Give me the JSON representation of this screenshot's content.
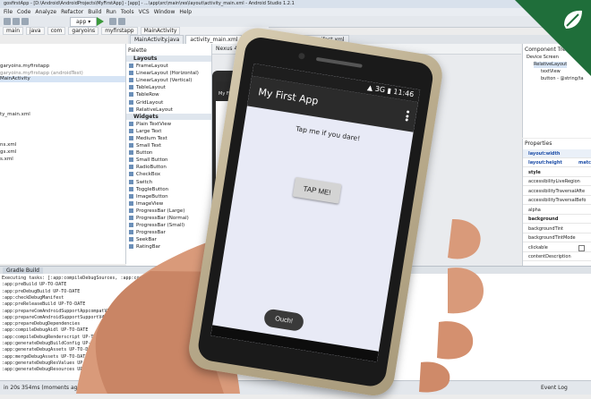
{
  "ide": {
    "title": "gosfirstApp - [D:\\Android\\AndroidProjects\\MyFirstApp] - [app] - ...\\app\\src\\main\\res\\layout\\activity_main.xml - Android Studio 1.2.1",
    "menu": [
      "File",
      "Code",
      "Analyze",
      "Refactor",
      "Build",
      "Run",
      "Tools",
      "VCS",
      "Window",
      "Help"
    ],
    "toolbar_module": "app",
    "breadcrumbs": [
      "main",
      "java",
      "com",
      "garyoins",
      "myfirstapp",
      "MainActivity"
    ],
    "editor_tabs": [
      {
        "label": "MainActivity.java",
        "active": false
      },
      {
        "label": "activity_main.xml",
        "active": true
      },
      {
        "label": "strings.xml",
        "active": false
      },
      {
        "label": "AndroidManifest.xml",
        "active": false
      }
    ],
    "project_tree": [
      {
        "label": "garyoins.myfirstapp",
        "style": "normal"
      },
      {
        "label": "garyoins.myfirstapp (androidTest)",
        "style": "faint"
      },
      {
        "label": "MainActivity",
        "style": "sel"
      },
      {
        "label": "ty_main.xml",
        "style": "normal"
      },
      {
        "label": "ns.xml",
        "style": "normal"
      },
      {
        "label": "gs.xml",
        "style": "normal"
      },
      {
        "label": "s.xml",
        "style": "normal"
      }
    ],
    "palette": {
      "title": "Palette",
      "sections": [
        {
          "name": "Layouts",
          "items": [
            "FrameLayout",
            "LinearLayout (Horizontal)",
            "LinearLayout (Vertical)",
            "TableLayout",
            "TableRow",
            "GridLayout",
            "RelativeLayout"
          ]
        },
        {
          "name": "Widgets",
          "items": [
            "Plain TextView",
            "Large Text",
            "Medium Text",
            "Small Text",
            "Button",
            "Small Button",
            "RadioButton",
            "CheckBox",
            "Switch",
            "ToggleButton",
            "ImageButton",
            "ImageView",
            "ProgressBar (Large)",
            "ProgressBar (Normal)",
            "ProgressBar (Small)",
            "ProgressBar",
            "SeekBar",
            "RatingBar"
          ]
        }
      ]
    },
    "canvas_toolbar": [
      "Nexus 4",
      "AppTheme",
      "API 22"
    ],
    "preview_title": "My First App",
    "component_tree": {
      "title": "Component Tree",
      "items": [
        {
          "label": "Device Screen"
        },
        {
          "label": "RelativeLayout"
        },
        {
          "label": "textView"
        },
        {
          "label": "button - @string/ta"
        }
      ]
    },
    "properties": {
      "title": "Properties",
      "header": "layout:width",
      "rows": [
        {
          "label": "layout:height",
          "value": "match",
          "style": "blue"
        },
        {
          "label": "style",
          "value": "",
          "style": "b"
        },
        {
          "label": "accessibilityLiveRegion",
          "value": "",
          "style": ""
        },
        {
          "label": "accessibilityTraversalAfte",
          "value": "",
          "style": ""
        },
        {
          "label": "accessibilityTraversalBefo",
          "value": "",
          "style": ""
        },
        {
          "label": "alpha",
          "value": "",
          "style": ""
        },
        {
          "label": "background",
          "value": "",
          "style": "b"
        },
        {
          "label": "backgroundTint",
          "value": "",
          "style": ""
        },
        {
          "label": "backgroundTintMode",
          "value": "",
          "style": ""
        },
        {
          "label": "clickable",
          "value": "",
          "style": ""
        },
        {
          "label": "contentDescription",
          "value": "",
          "style": ""
        }
      ]
    },
    "bottom_tabs": [
      "Gradle Build"
    ],
    "console_lines": [
      "Executing tasks: [:app:compileDebugSources, :app:compileDebugAndroidTestSources]",
      ":app:preBuild UP-TO-DATE",
      ":app:preDebugBuild UP-TO-DATE",
      ":app:checkDebugManifest",
      ":app:preReleaseBuild UP-TO-DATE",
      ":app:prepareComAndroidSupportAppcompatV72221Library",
      ":app:prepareComAndroidSupportSupportV42221Library",
      ":app:prepareDebugDependencies",
      ":app:compileDebugAidl UP-TO-DATE",
      ":app:compileDebugRenderscript UP-TO-DATE",
      ":app:generateDebugBuildConfig UP-TO-DATE",
      ":app:generateDebugAssets UP-TO-DATE",
      ":app:mergeDebugAssets UP-TO-DATE",
      ":app:generateDebugResValues UP-TO-DATE",
      ":app:generateDebugResources UP-TO-DATE"
    ],
    "status_left": "in 20s 354ms (moments ago)",
    "status_tab": "Terminal",
    "status_right": "Event Log"
  },
  "device": {
    "status_time": "11:46",
    "status_network": "3G",
    "app_title": "My First App",
    "label_text": "Tap me if you dare!",
    "button_label": "TAP ME!",
    "toast_text": "Ouch!"
  },
  "colors": {
    "appbar": "#2b2b2b",
    "screen_bg": "#e8eaf6",
    "corner_brand": "#1f6e3a",
    "phone_gold": "#c9bc9c"
  }
}
